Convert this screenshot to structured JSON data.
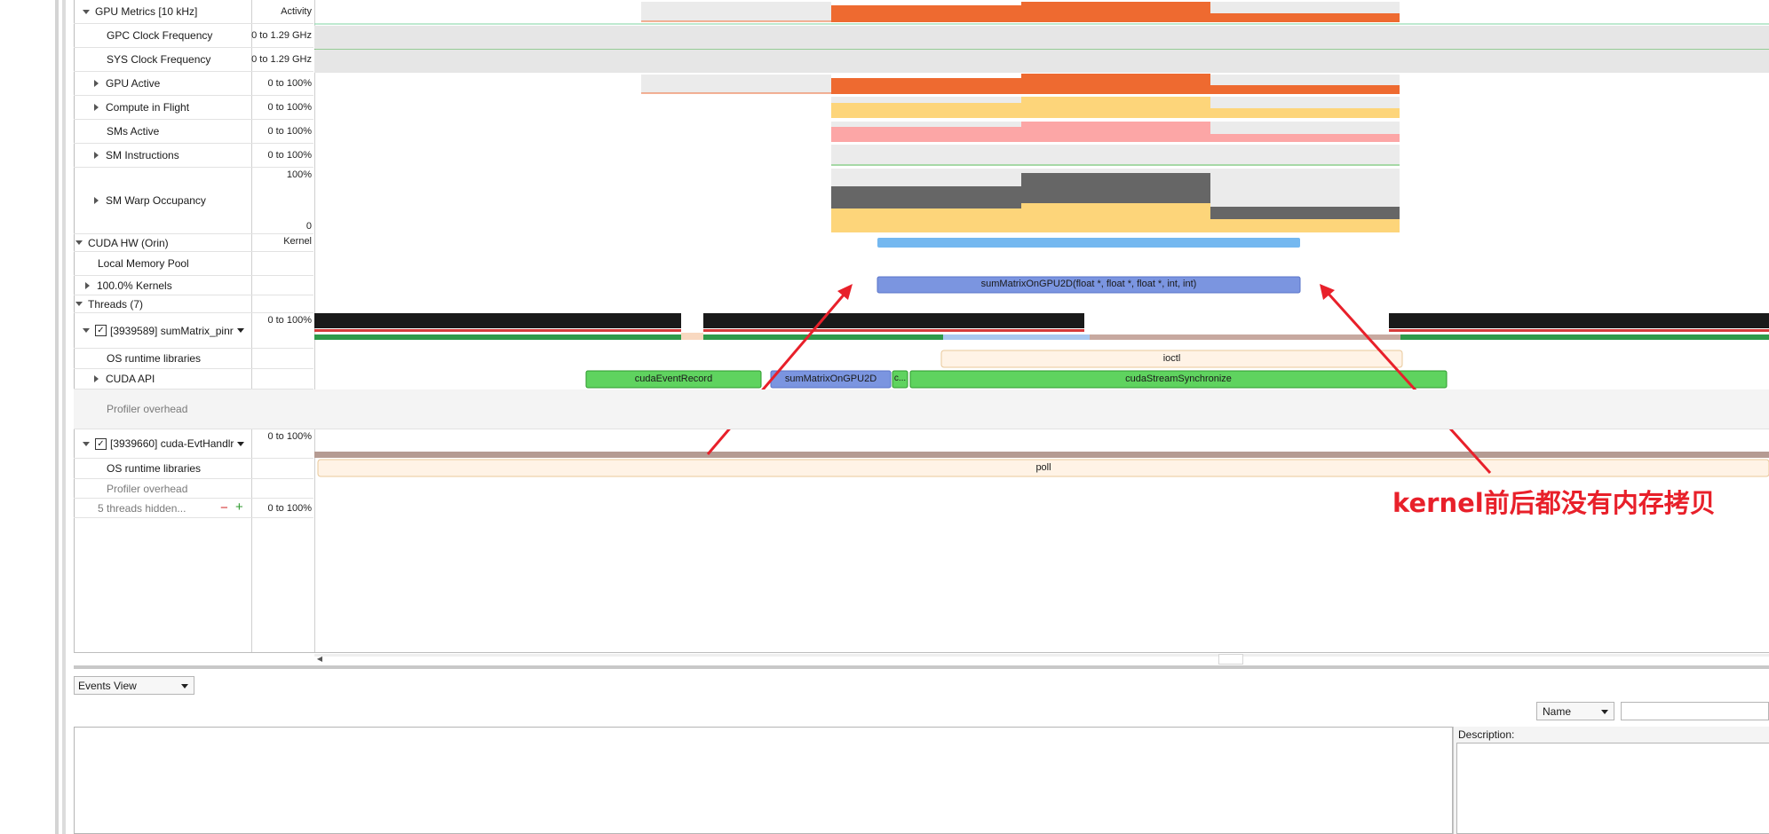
{
  "timeline": {
    "rows": [
      {
        "key": "gpu_metrics",
        "label": "GPU Metrics [10 kHz]",
        "scale": "Activity"
      },
      {
        "key": "gpc_clock",
        "label": "GPC Clock Frequency",
        "scale": "0 to 1.29 GHz"
      },
      {
        "key": "sys_clock",
        "label": "SYS Clock Frequency",
        "scale": "0 to 1.29 GHz"
      },
      {
        "key": "gpu_active",
        "label": "GPU Active",
        "scale": "0 to 100%"
      },
      {
        "key": "compute_in_flight",
        "label": "Compute in Flight",
        "scale": "0 to 100%"
      },
      {
        "key": "sms_active",
        "label": "SMs Active",
        "scale": "0 to 100%"
      },
      {
        "key": "sm_instructions",
        "label": "SM Instructions",
        "scale": "0 to 100%"
      },
      {
        "key": "sm_warp",
        "label": "SM Warp Occupancy",
        "scale_top": "100%",
        "scale_bottom": "0"
      },
      {
        "key": "cuda_hw",
        "label": "CUDA HW (Orin)",
        "scale": "Kernel"
      },
      {
        "key": "local_mem",
        "label": "Local Memory Pool"
      },
      {
        "key": "kernels",
        "label": "100.0% Kernels"
      },
      {
        "key": "threads",
        "label": "Threads (7)"
      },
      {
        "key": "thread1",
        "label": "[3939589] sumMatrix_pinr",
        "scale": "0 to 100%"
      },
      {
        "key": "os_rt1",
        "label": "OS runtime libraries"
      },
      {
        "key": "cuda_api",
        "label": "CUDA API"
      },
      {
        "key": "prof1",
        "label": "Profiler overhead"
      },
      {
        "key": "thread2",
        "label": "[3939660] cuda-EvtHandlr",
        "scale": "0 to 100%"
      },
      {
        "key": "os_rt2",
        "label": "OS runtime libraries"
      },
      {
        "key": "prof2",
        "label": "Profiler overhead"
      },
      {
        "key": "hidden",
        "label": "5 threads hidden...",
        "scale": "0 to 100%"
      }
    ],
    "bars": {
      "kernel_name": "sumMatrixOnGPU2D(float *, float *, float *, int, int)",
      "ioctl": "ioctl",
      "cuda_event_record": "cudaEventRecord",
      "sum_matrix_launch": "sumMatrixOnGPU2D",
      "small_call": "c...",
      "stream_sync": "cudaStreamSynchronize",
      "poll": "poll"
    },
    "colors": {
      "orange": "#ee6a30",
      "yellow": "#fdd57a",
      "pink": "#fca6a6",
      "kernel_blue": "#7b95e0",
      "hw_blue": "#74b8f0",
      "api_green": "#5fd35f",
      "dark_gray": "#666666",
      "annotation_red": "#e8202a"
    }
  },
  "annotation": {
    "text": "kernel前后都没有内存拷贝"
  },
  "bottom_panel": {
    "view_select": "Events View",
    "name_select": "Name",
    "search_value": "",
    "description_label": "Description:"
  }
}
